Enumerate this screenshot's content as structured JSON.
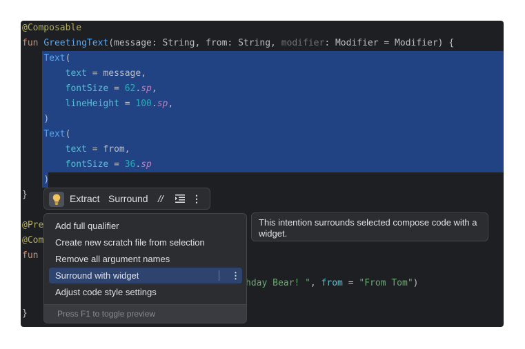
{
  "code": {
    "l1": {
      "ann": "@Composable"
    },
    "l2": {
      "fun": "fun",
      "name": "GreetingText",
      "p1": "(message: String, from: String, ",
      "p2": "modifier",
      "p3": ": Modifier = Modifier) {"
    },
    "l3": {
      "call": "Text",
      "rest": "("
    },
    "l4": {
      "arg": "text",
      "eq": " = message,"
    },
    "l5": {
      "arg": "fontSize",
      "eq": " = ",
      "num": "62",
      "dot": ".",
      "unit": "sp",
      "end": ","
    },
    "l6": {
      "arg": "lineHeight",
      "eq": " = ",
      "num": "100",
      "dot": ".",
      "unit": "sp",
      "end": ","
    },
    "l7": {
      "close": ")"
    },
    "l8": {
      "call": "Text",
      "rest": "("
    },
    "l9": {
      "arg": "text",
      "eq": " = from,"
    },
    "l10": {
      "arg": "fontSize",
      "eq": " = ",
      "num": "36",
      "dot": ".",
      "unit": "sp"
    },
    "l11": {
      "close": ")"
    },
    "l12": {
      "brace": "}"
    },
    "l14": {
      "ann": "@Pre"
    },
    "l15": {
      "ann": "@Com"
    },
    "l16": {
      "fun": "fun"
    },
    "l18": {
      "s1": "hday Bear! \"",
      "comma": ", ",
      "named": "from",
      "eq": " = ",
      "s2": "\"From Tom\"",
      "close": ")"
    },
    "l20": {
      "brace": "}"
    }
  },
  "toolbar": {
    "extract": "Extract",
    "surround": "Surround",
    "comment": "//",
    "more": "⋮"
  },
  "menu": {
    "items": [
      "Add full qualifier",
      "Create new scratch file from selection",
      "Remove all argument names",
      "Surround with widget",
      "Adjust code style settings"
    ],
    "more": "⋮",
    "footer": "Press F1 to toggle preview"
  },
  "tooltip": {
    "text": "This intention surrounds selected compose code with a widget."
  },
  "colors": {
    "editor_bg": "#1e1f22",
    "selection": "#214283",
    "popup_bg": "#2b2d30",
    "active_item": "#2e436e",
    "bulb": "#f2c55c"
  }
}
